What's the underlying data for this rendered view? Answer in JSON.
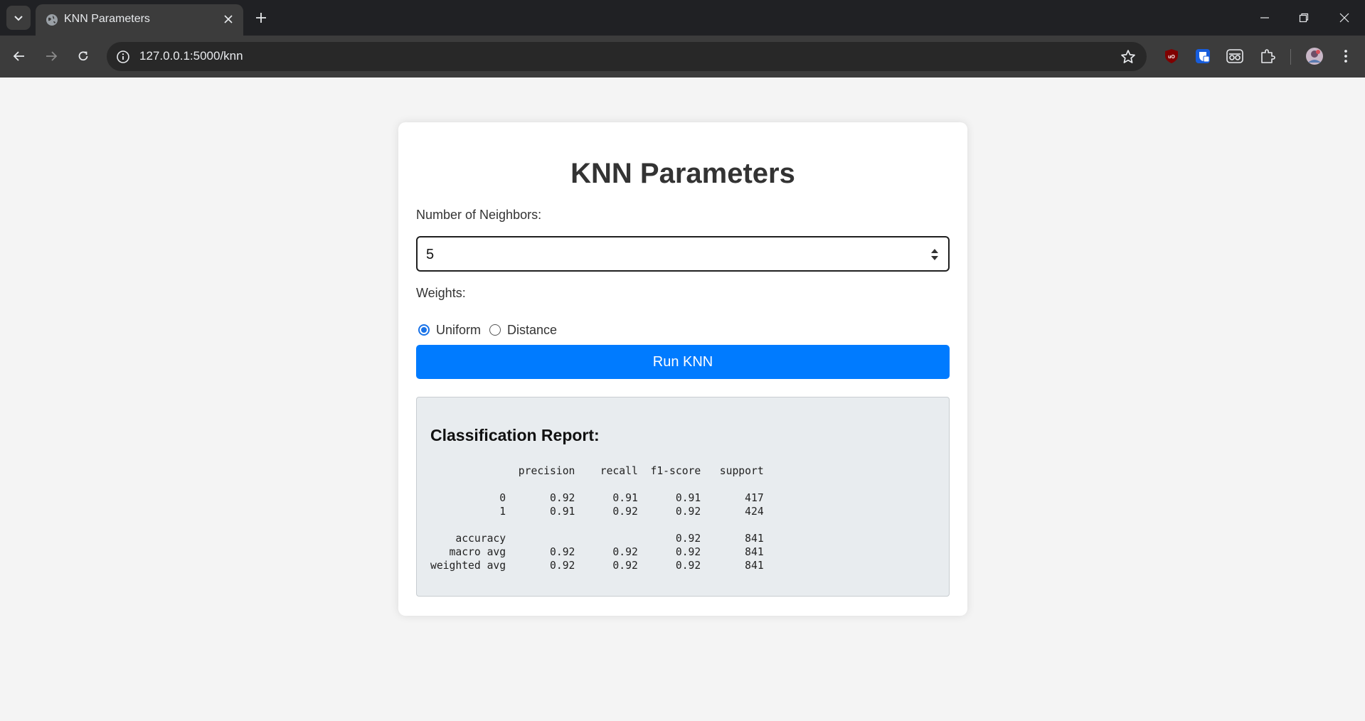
{
  "browser": {
    "tab_title": "KNN Parameters",
    "url": "127.0.0.1:5000/knn",
    "icons": [
      "tab-search-icon",
      "globe-icon",
      "close-icon",
      "plus-icon",
      "minimize-icon",
      "restore-icon",
      "close-window-icon",
      "back-icon",
      "forward-icon",
      "reload-icon",
      "info-icon",
      "star-icon",
      "ublock-icon",
      "bitwarden-icon",
      "incognito-icon",
      "puzzle-icon",
      "avatar",
      "more-vert-icon"
    ]
  },
  "page": {
    "title": "KNN Parameters",
    "neighbors_label": "Number of Neighbors:",
    "neighbors_value": "5",
    "weights_label": "Weights:",
    "weights_options": [
      {
        "label": "Uniform",
        "checked": true
      },
      {
        "label": "Distance",
        "checked": false
      }
    ],
    "run_button": "Run KNN",
    "report_title": "Classification Report:",
    "report_text": "              precision    recall  f1-score   support\n\n           0       0.92      0.91      0.91       417\n           1       0.91      0.92      0.92       424\n\n    accuracy                           0.92       841\n   macro avg       0.92      0.92      0.92       841\nweighted avg       0.92      0.92      0.92       841"
  },
  "colors": {
    "primary_button": "#007bff",
    "radio_accent": "#1a73e8",
    "page_background": "#f4f4f4",
    "report_background": "#e8ecef"
  }
}
